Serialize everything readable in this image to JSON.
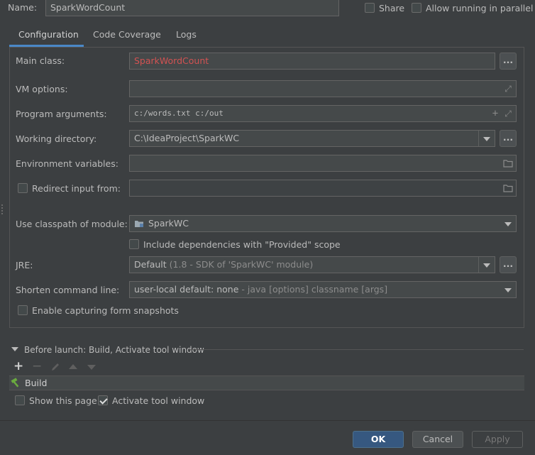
{
  "header": {
    "name_label": "Name:",
    "name_value": "SparkWordCount",
    "share_label": "Share",
    "parallel_label": "Allow running in parallel"
  },
  "tabs": [
    {
      "label": "Configuration",
      "active": true
    },
    {
      "label": "Code Coverage"
    },
    {
      "label": "Logs"
    }
  ],
  "form": {
    "main_class_label": "Main class:",
    "main_class_value": "SparkWordCount",
    "vm_options_label": "VM options:",
    "vm_options_value": "",
    "program_args_label": "Program arguments:",
    "program_args_value": "c:/words.txt c:/out",
    "working_dir_label": "Working directory:",
    "working_dir_value": "C:\\IdeaProject\\SparkWC",
    "env_vars_label": "Environment variables:",
    "env_vars_value": "",
    "redirect_label": "Redirect input from:",
    "redirect_value": "",
    "classpath_label": "Use classpath of module:",
    "classpath_value": "SparkWC",
    "include_deps_label": "Include dependencies with \"Provided\" scope",
    "jre_label": "JRE:",
    "jre_value": "Default",
    "jre_hint": "(1.8 - SDK of 'SparkWC' module)",
    "shorten_label": "Shorten command line:",
    "shorten_value": "user-local default: none",
    "shorten_hint": "- java [options] classname [args]",
    "capture_label": "Enable capturing form snapshots",
    "browse_label": "..."
  },
  "before_launch": {
    "title": "Before launch: Build, Activate tool window",
    "tasks": [
      "Build"
    ],
    "show_page_label": "Show this page",
    "activate_label": "Activate tool window"
  },
  "buttons": {
    "ok": "OK",
    "cancel": "Cancel",
    "apply": "Apply"
  },
  "colors": {
    "accent": "#4a88c7",
    "error_text": "#d25252",
    "background": "#3c3f41"
  }
}
